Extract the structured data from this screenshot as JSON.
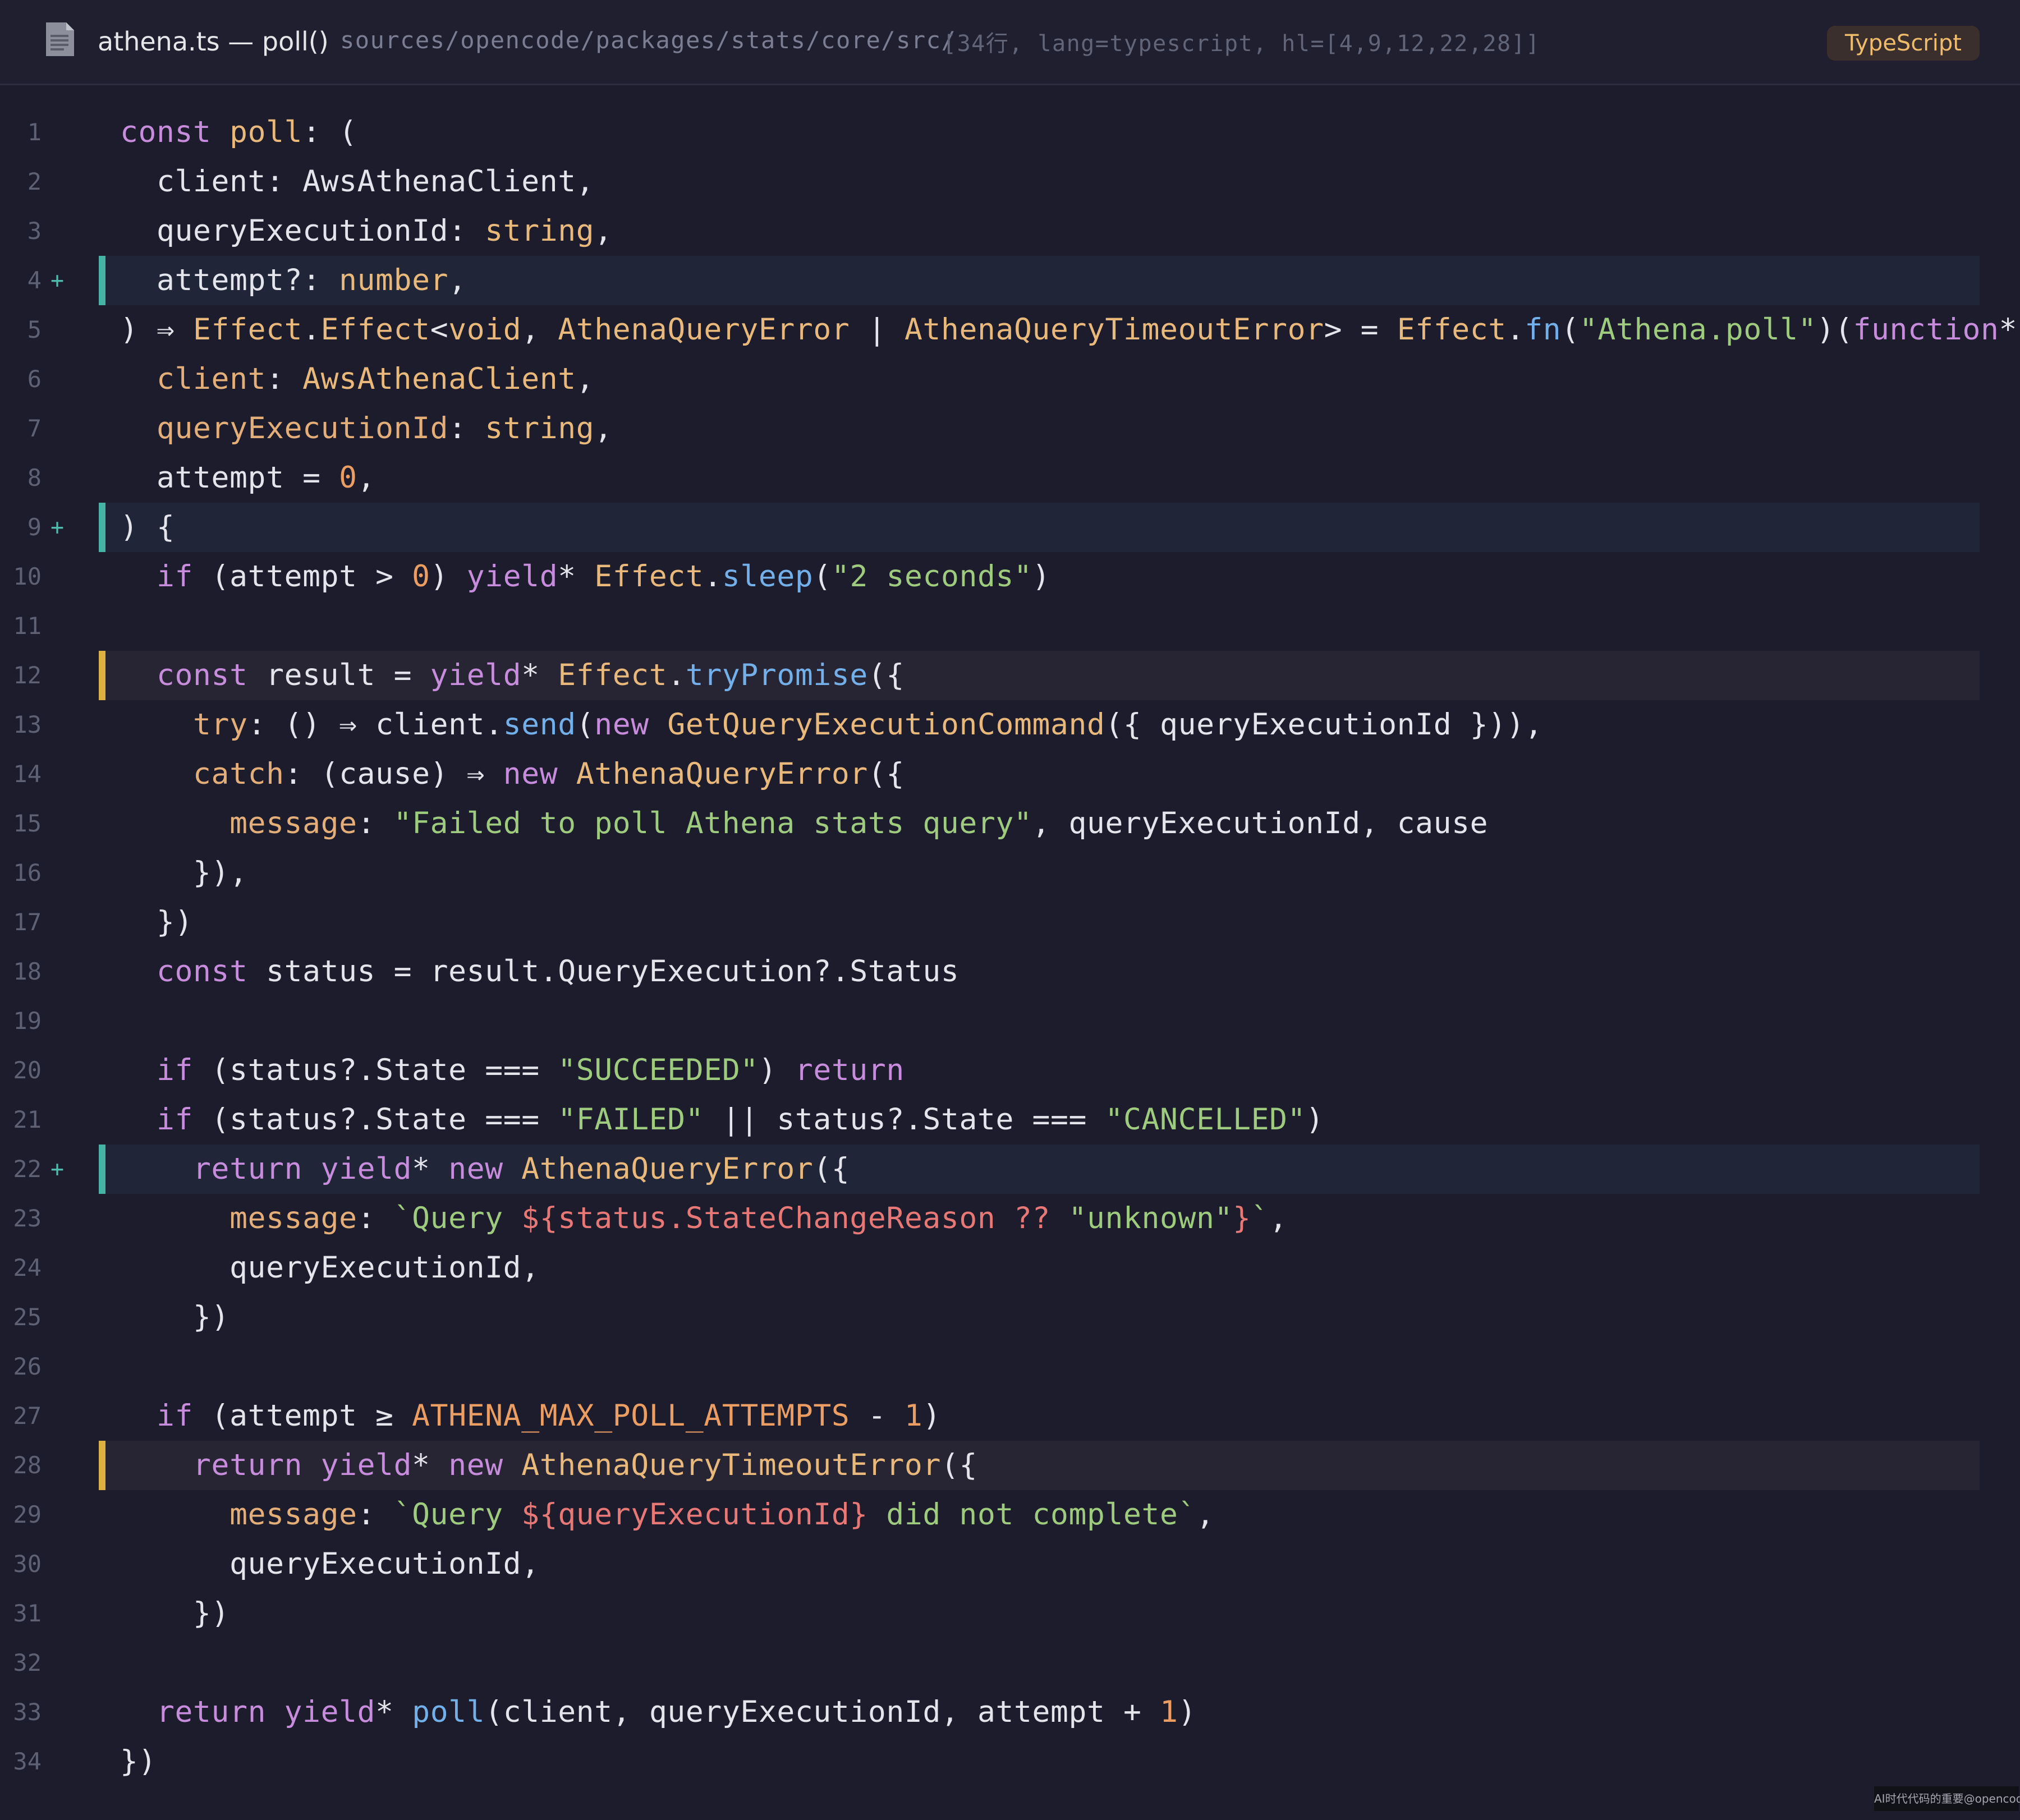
{
  "header": {
    "file_icon": "document-icon",
    "title": "athena.ts — poll()",
    "path": "sources/opencode/packages/stats/core/src/",
    "meta": "[34行, lang=typescript, hl=[4,9,12,22,28]]",
    "language_badge": "TypeScript"
  },
  "colors": {
    "background": "#1c1c2c",
    "added_line_bar": "#46b3a7",
    "warn_line_bar": "#ddb042",
    "keyword": "#c78ddc",
    "function": "#73b0ea",
    "type": "#e9b87b",
    "string": "#9ecb7e",
    "number": "#eb9d62",
    "template_expr": "#e77876"
  },
  "code": {
    "lines": [
      {
        "n": "1",
        "mark": "",
        "hl": "",
        "tokens": [
          [
            "kw",
            "const "
          ],
          [
            "ty",
            "poll"
          ],
          [
            "pl",
            ": ("
          ]
        ]
      },
      {
        "n": "2",
        "mark": "",
        "hl": "",
        "tokens": [
          [
            "pl",
            "  client: AwsAthenaClient,"
          ]
        ]
      },
      {
        "n": "3",
        "mark": "",
        "hl": "",
        "tokens": [
          [
            "pl",
            "  queryExecutionId: "
          ],
          [
            "ty",
            "string"
          ],
          [
            "pl",
            ","
          ]
        ]
      },
      {
        "n": "4",
        "mark": "+",
        "hl": "add",
        "tokens": [
          [
            "pl",
            "  attempt?: "
          ],
          [
            "ty",
            "number"
          ],
          [
            "pl",
            ","
          ]
        ]
      },
      {
        "n": "5",
        "mark": "",
        "hl": "",
        "tokens": [
          [
            "pl",
            ") ⇒ "
          ],
          [
            "ty",
            "Effect"
          ],
          [
            "pl",
            "."
          ],
          [
            "ty",
            "Effect"
          ],
          [
            "pl",
            "<"
          ],
          [
            "ty",
            "void"
          ],
          [
            "pl",
            ", "
          ],
          [
            "ty",
            "AthenaQueryError"
          ],
          [
            "pl",
            " | "
          ],
          [
            "ty",
            "AthenaQueryTimeoutError"
          ],
          [
            "pl",
            "> = "
          ],
          [
            "ty",
            "Effect"
          ],
          [
            "pl",
            "."
          ],
          [
            "fn",
            "fn"
          ],
          [
            "pl",
            "("
          ],
          [
            "str",
            "\"Athena.poll\""
          ],
          [
            "pl",
            ")("
          ],
          [
            "kw",
            "function"
          ],
          [
            "pl",
            "*"
          ]
        ]
      },
      {
        "n": "6",
        "mark": "",
        "hl": "",
        "tokens": [
          [
            "pl",
            "  "
          ],
          [
            "prop",
            "client"
          ],
          [
            "pl",
            ": "
          ],
          [
            "ty",
            "AwsAthenaClient"
          ],
          [
            "pl",
            ","
          ]
        ]
      },
      {
        "n": "7",
        "mark": "",
        "hl": "",
        "tokens": [
          [
            "pl",
            "  "
          ],
          [
            "prop",
            "queryExecutionId"
          ],
          [
            "pl",
            ": "
          ],
          [
            "ty",
            "string"
          ],
          [
            "pl",
            ","
          ]
        ]
      },
      {
        "n": "8",
        "mark": "",
        "hl": "",
        "tokens": [
          [
            "pl",
            "  attempt = "
          ],
          [
            "num",
            "0"
          ],
          [
            "pl",
            ","
          ]
        ]
      },
      {
        "n": "9",
        "mark": "+",
        "hl": "add",
        "tokens": [
          [
            "pl",
            ") {"
          ]
        ]
      },
      {
        "n": "10",
        "mark": "",
        "hl": "",
        "tokens": [
          [
            "pl",
            "  "
          ],
          [
            "kw",
            "if"
          ],
          [
            "pl",
            " (attempt > "
          ],
          [
            "num",
            "0"
          ],
          [
            "pl",
            ") "
          ],
          [
            "kw",
            "yield"
          ],
          [
            "pl",
            "* "
          ],
          [
            "ty",
            "Effect"
          ],
          [
            "pl",
            "."
          ],
          [
            "fn",
            "sleep"
          ],
          [
            "pl",
            "("
          ],
          [
            "str",
            "\"2 seconds\""
          ],
          [
            "pl",
            ")"
          ]
        ]
      },
      {
        "n": "11",
        "mark": "",
        "hl": "",
        "tokens": []
      },
      {
        "n": "12",
        "mark": "",
        "hl": "warn",
        "tokens": [
          [
            "pl",
            "  "
          ],
          [
            "kw",
            "const"
          ],
          [
            "pl",
            " result = "
          ],
          [
            "kw",
            "yield"
          ],
          [
            "pl",
            "* "
          ],
          [
            "ty",
            "Effect"
          ],
          [
            "pl",
            "."
          ],
          [
            "fn",
            "tryPromise"
          ],
          [
            "pl",
            "({"
          ]
        ]
      },
      {
        "n": "13",
        "mark": "",
        "hl": "",
        "tokens": [
          [
            "pl",
            "    "
          ],
          [
            "prop",
            "try"
          ],
          [
            "pl",
            ": () ⇒ client."
          ],
          [
            "fn",
            "send"
          ],
          [
            "pl",
            "("
          ],
          [
            "kw",
            "new"
          ],
          [
            "pl",
            " "
          ],
          [
            "ty",
            "GetQueryExecutionCommand"
          ],
          [
            "pl",
            "({ queryExecutionId })),"
          ]
        ]
      },
      {
        "n": "14",
        "mark": "",
        "hl": "",
        "tokens": [
          [
            "pl",
            "    "
          ],
          [
            "prop",
            "catch"
          ],
          [
            "pl",
            ": (cause) ⇒ "
          ],
          [
            "kw",
            "new"
          ],
          [
            "pl",
            " "
          ],
          [
            "ty",
            "AthenaQueryError"
          ],
          [
            "pl",
            "({"
          ]
        ]
      },
      {
        "n": "15",
        "mark": "",
        "hl": "",
        "tokens": [
          [
            "pl",
            "      "
          ],
          [
            "prop",
            "message"
          ],
          [
            "pl",
            ": "
          ],
          [
            "str",
            "\"Failed to poll Athena stats query\""
          ],
          [
            "pl",
            ", queryExecutionId, cause"
          ]
        ]
      },
      {
        "n": "16",
        "mark": "",
        "hl": "",
        "tokens": [
          [
            "pl",
            "    }),"
          ]
        ]
      },
      {
        "n": "17",
        "mark": "",
        "hl": "",
        "tokens": [
          [
            "pl",
            "  })"
          ]
        ]
      },
      {
        "n": "18",
        "mark": "",
        "hl": "",
        "tokens": [
          [
            "pl",
            "  "
          ],
          [
            "kw",
            "const"
          ],
          [
            "pl",
            " status = result.QueryExecution?.Status"
          ]
        ]
      },
      {
        "n": "19",
        "mark": "",
        "hl": "",
        "tokens": []
      },
      {
        "n": "20",
        "mark": "",
        "hl": "",
        "tokens": [
          [
            "pl",
            "  "
          ],
          [
            "kw",
            "if"
          ],
          [
            "pl",
            " (status?.State === "
          ],
          [
            "str",
            "\"SUCCEEDED\""
          ],
          [
            "pl",
            ") "
          ],
          [
            "kw",
            "return"
          ]
        ]
      },
      {
        "n": "21",
        "mark": "",
        "hl": "",
        "tokens": [
          [
            "pl",
            "  "
          ],
          [
            "kw",
            "if"
          ],
          [
            "pl",
            " (status?.State === "
          ],
          [
            "str",
            "\"FAILED\""
          ],
          [
            "pl",
            " || status?.State === "
          ],
          [
            "str",
            "\"CANCELLED\""
          ],
          [
            "pl",
            ")"
          ]
        ]
      },
      {
        "n": "22",
        "mark": "+",
        "hl": "add",
        "tokens": [
          [
            "pl",
            "    "
          ],
          [
            "kw",
            "return"
          ],
          [
            "pl",
            " "
          ],
          [
            "kw",
            "yield"
          ],
          [
            "pl",
            "* "
          ],
          [
            "kw",
            "new"
          ],
          [
            "pl",
            " "
          ],
          [
            "ty",
            "AthenaQueryError"
          ],
          [
            "pl",
            "({"
          ]
        ]
      },
      {
        "n": "23",
        "mark": "",
        "hl": "",
        "tokens": [
          [
            "pl",
            "      "
          ],
          [
            "prop",
            "message"
          ],
          [
            "pl",
            ": "
          ],
          [
            "str",
            "`Query "
          ],
          [
            "tpl",
            "${status.StateChangeReason ?? "
          ],
          [
            "str",
            "\"unknown\""
          ],
          [
            "tpl",
            "}"
          ],
          [
            "str",
            "`"
          ],
          [
            "pl",
            ","
          ]
        ]
      },
      {
        "n": "24",
        "mark": "",
        "hl": "",
        "tokens": [
          [
            "pl",
            "      queryExecutionId,"
          ]
        ]
      },
      {
        "n": "25",
        "mark": "",
        "hl": "",
        "tokens": [
          [
            "pl",
            "    })"
          ]
        ]
      },
      {
        "n": "26",
        "mark": "",
        "hl": "",
        "tokens": []
      },
      {
        "n": "27",
        "mark": "",
        "hl": "",
        "tokens": [
          [
            "pl",
            "  "
          ],
          [
            "kw",
            "if"
          ],
          [
            "pl",
            " (attempt ≥ "
          ],
          [
            "num",
            "ATHENA_MAX_POLL_ATTEMPTS"
          ],
          [
            "pl",
            " - "
          ],
          [
            "num",
            "1"
          ],
          [
            "pl",
            ")"
          ]
        ]
      },
      {
        "n": "28",
        "mark": "",
        "hl": "warn",
        "tokens": [
          [
            "pl",
            "    "
          ],
          [
            "kw",
            "return"
          ],
          [
            "pl",
            " "
          ],
          [
            "kw",
            "yield"
          ],
          [
            "pl",
            "* "
          ],
          [
            "kw",
            "new"
          ],
          [
            "pl",
            " "
          ],
          [
            "ty",
            "AthenaQueryTimeoutError"
          ],
          [
            "pl",
            "({"
          ]
        ]
      },
      {
        "n": "29",
        "mark": "",
        "hl": "",
        "tokens": [
          [
            "pl",
            "      "
          ],
          [
            "prop",
            "message"
          ],
          [
            "pl",
            ": "
          ],
          [
            "str",
            "`Query "
          ],
          [
            "tpl",
            "${queryExecutionId}"
          ],
          [
            "str",
            " did not complete`"
          ],
          [
            "pl",
            ","
          ]
        ]
      },
      {
        "n": "30",
        "mark": "",
        "hl": "",
        "tokens": [
          [
            "pl",
            "      queryExecutionId,"
          ]
        ]
      },
      {
        "n": "31",
        "mark": "",
        "hl": "",
        "tokens": [
          [
            "pl",
            "    })"
          ]
        ]
      },
      {
        "n": "32",
        "mark": "",
        "hl": "",
        "tokens": []
      },
      {
        "n": "33",
        "mark": "",
        "hl": "",
        "tokens": [
          [
            "pl",
            "  "
          ],
          [
            "kw",
            "return"
          ],
          [
            "pl",
            " "
          ],
          [
            "kw",
            "yield"
          ],
          [
            "pl",
            "* "
          ],
          [
            "fn",
            "poll"
          ],
          [
            "pl",
            "(client, queryExecutionId, attempt + "
          ],
          [
            "num",
            "1"
          ],
          [
            "pl",
            ")"
          ]
        ]
      },
      {
        "n": "34",
        "mark": "",
        "hl": "",
        "tokens": [
          [
            "pl",
            "})"
          ]
        ]
      }
    ]
  },
  "watermark": "AI时代代码的重要@opencode.cn"
}
